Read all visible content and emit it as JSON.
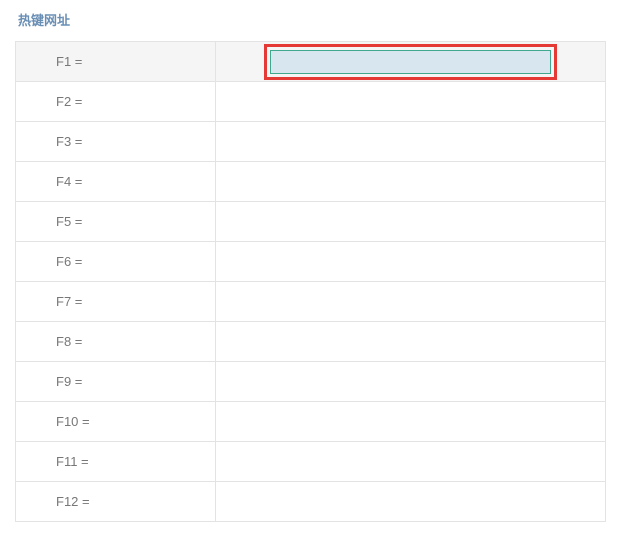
{
  "section": {
    "title": "热键网址"
  },
  "hotkeys": [
    {
      "label": "F1 =",
      "value": "",
      "selected": true
    },
    {
      "label": "F2 =",
      "value": "",
      "selected": false
    },
    {
      "label": "F3 =",
      "value": "",
      "selected": false
    },
    {
      "label": "F4 =",
      "value": "",
      "selected": false
    },
    {
      "label": "F5 =",
      "value": "",
      "selected": false
    },
    {
      "label": "F6 =",
      "value": "",
      "selected": false
    },
    {
      "label": "F7 =",
      "value": "",
      "selected": false
    },
    {
      "label": "F8 =",
      "value": "",
      "selected": false
    },
    {
      "label": "F9 =",
      "value": "",
      "selected": false
    },
    {
      "label": "F10 =",
      "value": "",
      "selected": false
    },
    {
      "label": "F11 =",
      "value": "",
      "selected": false
    },
    {
      "label": "F12 =",
      "value": "",
      "selected": false
    }
  ]
}
